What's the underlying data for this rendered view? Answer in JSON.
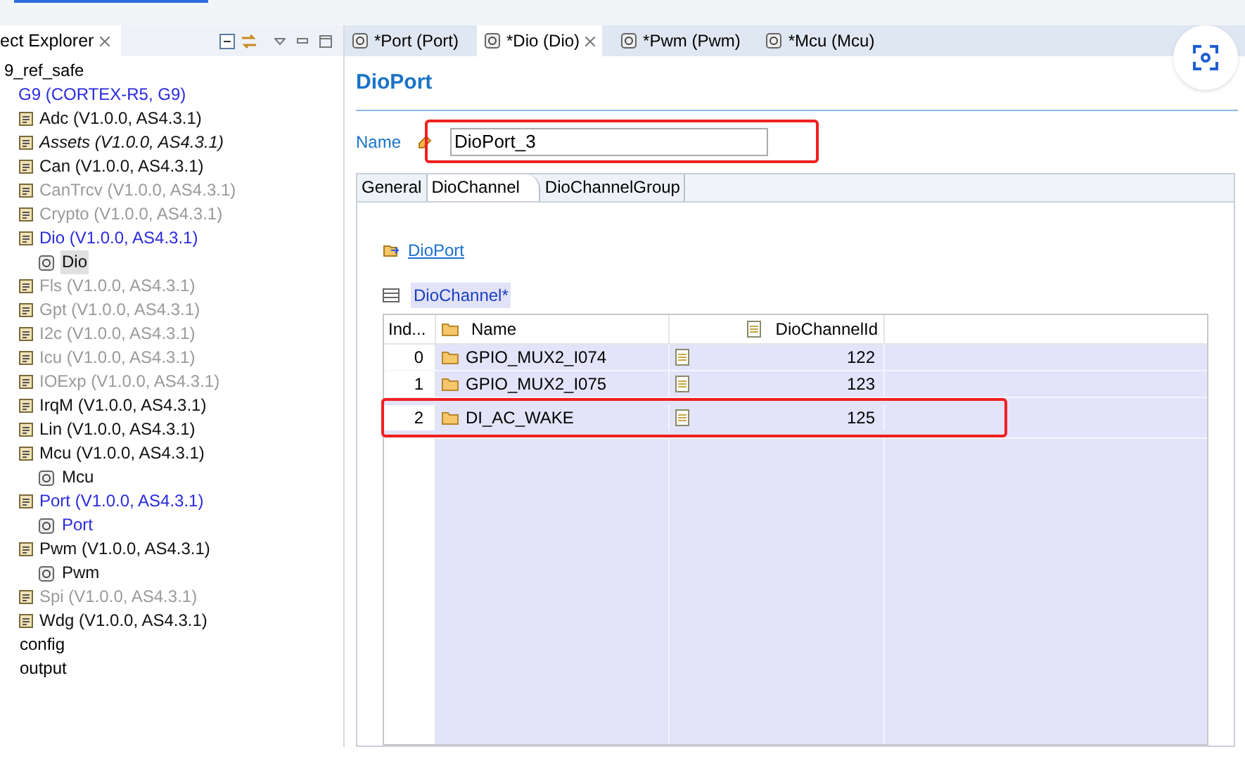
{
  "explorer": {
    "title": "ect Explorer",
    "root": "9_ref_safe",
    "ecu": {
      "label": "G9 (CORTEX-R5, G9)",
      "active": true
    },
    "items": [
      {
        "label": "Adc (V1.0.0, AS4.3.1)",
        "active": false,
        "disabled": false,
        "italic": false,
        "selected": false
      },
      {
        "label": "Assets (V1.0.0, AS4.3.1)",
        "active": false,
        "disabled": false,
        "italic": true,
        "selected": false
      },
      {
        "label": "Can (V1.0.0, AS4.3.1)",
        "active": false,
        "disabled": false,
        "italic": false,
        "selected": false
      },
      {
        "label": "CanTrcv (V1.0.0, AS4.3.1)",
        "active": false,
        "disabled": true,
        "italic": false,
        "selected": false
      },
      {
        "label": "Crypto (V1.0.0, AS4.3.1)",
        "active": false,
        "disabled": true,
        "italic": false,
        "selected": false
      },
      {
        "label": "Dio (V1.0.0, AS4.3.1)",
        "active": true,
        "disabled": false,
        "italic": false,
        "selected": false,
        "children": [
          {
            "label": "Dio",
            "active": false,
            "disabled": false,
            "italic": false,
            "selected": true
          }
        ]
      },
      {
        "label": "Fls (V1.0.0, AS4.3.1)",
        "active": false,
        "disabled": true,
        "italic": false,
        "selected": false
      },
      {
        "label": "Gpt (V1.0.0, AS4.3.1)",
        "active": false,
        "disabled": true,
        "italic": false,
        "selected": false
      },
      {
        "label": "I2c (V1.0.0, AS4.3.1)",
        "active": false,
        "disabled": true,
        "italic": false,
        "selected": false
      },
      {
        "label": "Icu (V1.0.0, AS4.3.1)",
        "active": false,
        "disabled": true,
        "italic": false,
        "selected": false
      },
      {
        "label": "IOExp (V1.0.0, AS4.3.1)",
        "active": false,
        "disabled": true,
        "italic": false,
        "selected": false
      },
      {
        "label": "IrqM (V1.0.0, AS4.3.1)",
        "active": false,
        "disabled": false,
        "italic": false,
        "selected": false
      },
      {
        "label": "Lin (V1.0.0, AS4.3.1)",
        "active": false,
        "disabled": false,
        "italic": false,
        "selected": false
      },
      {
        "label": "Mcu (V1.0.0, AS4.3.1)",
        "active": false,
        "disabled": false,
        "italic": false,
        "selected": false,
        "children": [
          {
            "label": "Mcu",
            "active": false,
            "disabled": false,
            "italic": false,
            "selected": false
          }
        ]
      },
      {
        "label": "Port (V1.0.0, AS4.3.1)",
        "active": true,
        "disabled": false,
        "italic": false,
        "selected": false,
        "children": [
          {
            "label": "Port",
            "active": true,
            "disabled": false,
            "italic": false,
            "selected": false
          }
        ]
      },
      {
        "label": "Pwm (V1.0.0, AS4.3.1)",
        "active": false,
        "disabled": false,
        "italic": false,
        "selected": false,
        "children": [
          {
            "label": "Pwm",
            "active": false,
            "disabled": false,
            "italic": false,
            "selected": false
          }
        ]
      },
      {
        "label": "Spi (V1.0.0, AS4.3.1)",
        "active": false,
        "disabled": true,
        "italic": false,
        "selected": false
      },
      {
        "label": "Wdg (V1.0.0, AS4.3.1)",
        "active": false,
        "disabled": false,
        "italic": false,
        "selected": false
      }
    ],
    "folders": [
      "config",
      "output"
    ]
  },
  "editor_tabs": [
    {
      "label": "*Port (Port)",
      "selected": false
    },
    {
      "label": "*Dio (Dio)",
      "selected": true
    },
    {
      "label": "*Pwm (Pwm)",
      "selected": false
    },
    {
      "label": "*Mcu (Mcu)",
      "selected": false
    }
  ],
  "heading": "DioPort",
  "name_field": {
    "label": "Name",
    "value": "DioPort_3"
  },
  "sub_tabs": [
    {
      "label": "General",
      "selected": false
    },
    {
      "label": "DioChannel",
      "selected": true
    },
    {
      "label": "DioChannelGroup",
      "selected": false
    }
  ],
  "parent_link": "DioPort",
  "table": {
    "title": "DioChannel*",
    "columns": [
      "Ind...",
      "Name",
      "DioChannelId"
    ],
    "rows": [
      {
        "index": "0",
        "name": "GPIO_MUX2_I074",
        "id": "122",
        "highlighted": false
      },
      {
        "index": "1",
        "name": "GPIO_MUX2_I075",
        "id": "123",
        "highlighted": false
      },
      {
        "index": "2",
        "name": "DI_AC_WAKE",
        "id": "125",
        "highlighted": true
      }
    ]
  }
}
